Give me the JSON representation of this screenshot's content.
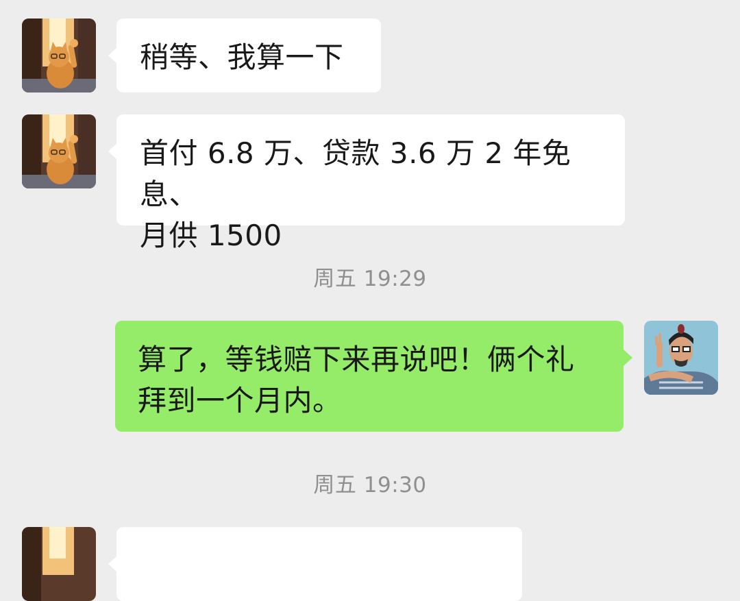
{
  "messages": [
    {
      "side": "in",
      "avatar": "cat-waving-avatar",
      "lines": [
        "稍等、我算一下"
      ]
    },
    {
      "side": "in",
      "avatar": "cat-waving-avatar",
      "lines": [
        "首付 6.8 万、贷款 3.6 万 2 年免息、",
        "月供 1500"
      ]
    },
    {
      "side": "out",
      "avatar": "cartoon-man-avatar",
      "lines": [
        "算了，等钱赔下来再说吧！俩个礼",
        "拜到一个月内。"
      ]
    }
  ],
  "timestamps": [
    "周五 19:29",
    "周五 19:30"
  ],
  "colors": {
    "background": "#ededed",
    "incoming_bubble": "#ffffff",
    "outgoing_bubble": "#95ec69",
    "timestamp_text": "#8f8f8f"
  }
}
